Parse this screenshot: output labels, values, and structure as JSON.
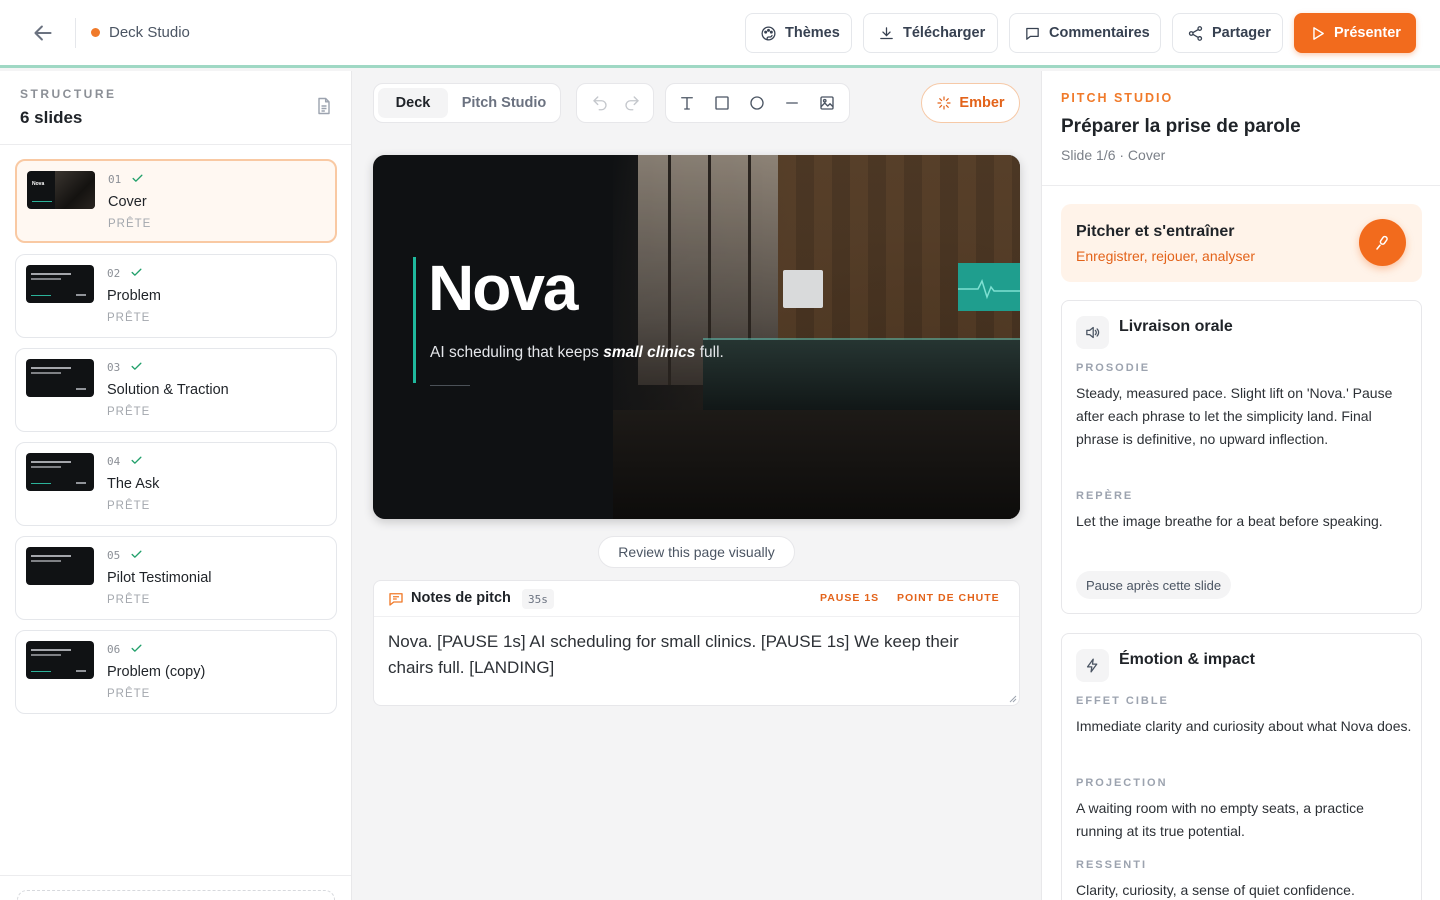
{
  "topbar": {
    "app_title": "Deck Studio",
    "buttons": {
      "themes": "Thèmes",
      "download": "Télécharger",
      "comments": "Commentaires",
      "share": "Partager",
      "present": "Présenter"
    },
    "accent_color": "#f26b1d"
  },
  "sidebar": {
    "section_label": "STRUCTURE",
    "count_label": "6 slides",
    "slides": [
      {
        "num": "01",
        "title": "Cover",
        "status": "PRÊTE",
        "active": true
      },
      {
        "num": "02",
        "title": "Problem",
        "status": "PRÊTE"
      },
      {
        "num": "03",
        "title": "Solution & Traction",
        "status": "PRÊTE"
      },
      {
        "num": "04",
        "title": "The Ask",
        "status": "PRÊTE"
      },
      {
        "num": "05",
        "title": "Pilot Testimonial",
        "status": "PRÊTE"
      },
      {
        "num": "06",
        "title": "Problem (copy)",
        "status": "PRÊTE"
      }
    ]
  },
  "editor": {
    "tabs": {
      "deck": "Deck",
      "pitch_studio": "Pitch Studio"
    },
    "tools": [
      "undo-icon",
      "redo-icon",
      "text-icon",
      "rectangle-icon",
      "circle-icon",
      "line-icon",
      "image-icon"
    ],
    "ember_label": "Ember",
    "slide": {
      "title": "Nova",
      "subtitle_prefix": "AI scheduling that keeps ",
      "subtitle_emphasis": "small clinics",
      "subtitle_suffix": " full.",
      "accent_color": "#1fb89d"
    },
    "review_label": "Review this page visually",
    "notes": {
      "title": "Notes de pitch",
      "duration": "35s",
      "tag_pause": "PAUSE 1S",
      "tag_landing": "POINT DE CHUTE",
      "text": "Nova. [PAUSE 1s] AI scheduling for small clinics. [PAUSE 1s] We keep their chairs full. [LANDING]"
    }
  },
  "panel": {
    "kicker": "PITCH STUDIO",
    "title": "Préparer la prise de parole",
    "subtitle": "Slide 1/6 · Cover",
    "practice": {
      "title": "Pitcher et s'entraîner",
      "subtitle": "Enregistrer, rejouer, analyser"
    },
    "delivery": {
      "title": "Livraison orale",
      "prosody_label": "PROSODIE",
      "prosody_text": "Steady, measured pace. Slight lift on 'Nova.' Pause after each phrase to let the simplicity land. Final phrase is definitive, no upward inflection.",
      "cue_label": "REPÈRE",
      "cue_text": "Let the image breathe for a beat before speaking.",
      "chip": "Pause après cette slide"
    },
    "emotion": {
      "title": "Émotion & impact",
      "effect_label": "EFFET CIBLE",
      "effect_text": "Immediate clarity and curiosity about what Nova does.",
      "projection_label": "PROJECTION",
      "projection_text": "A waiting room with no empty seats, a practice running at its true potential.",
      "feeling_label": "RESSENTI",
      "feeling_text": "Clarity, curiosity, a sense of quiet confidence."
    }
  }
}
